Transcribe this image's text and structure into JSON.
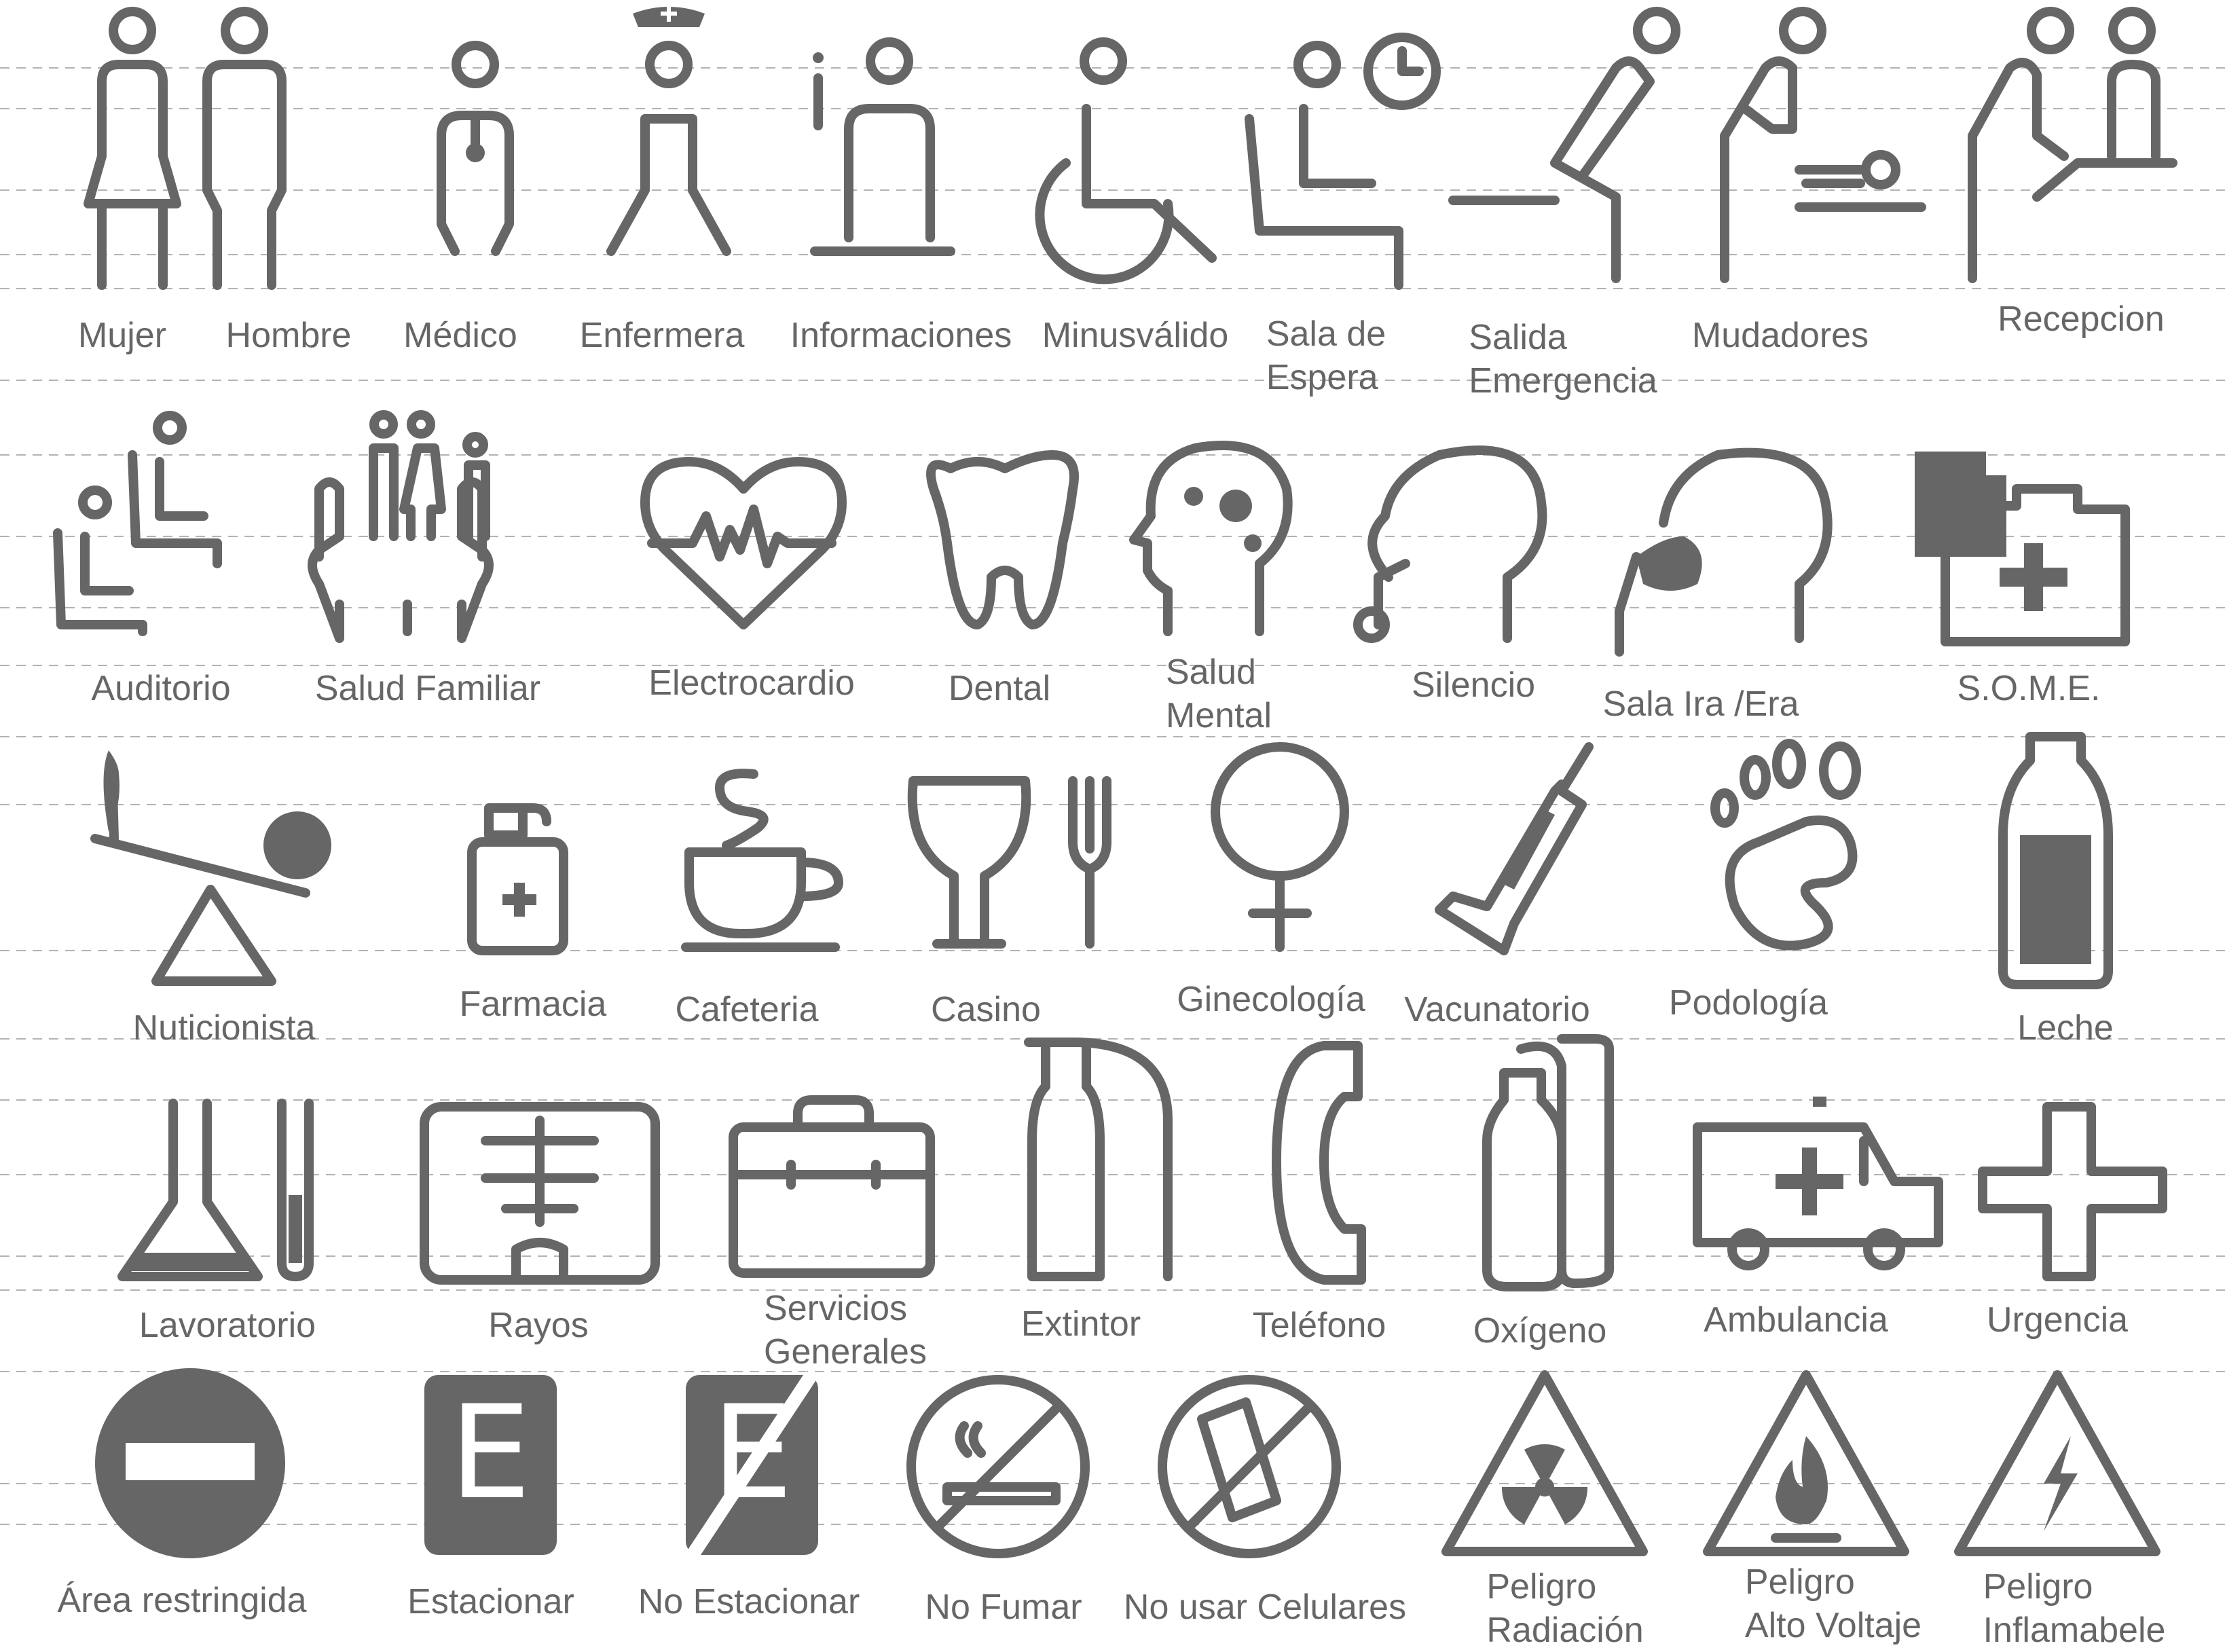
{
  "colors": {
    "icon": "#666666",
    "guides": "#b3b3b3",
    "background": "#ffffff"
  },
  "labels": {
    "mujer": "Mujer",
    "hombre": "Hombre",
    "medico": "Médico",
    "enfermera": "Enfermera",
    "informaciones": "Informaciones",
    "minusvalido": "Minusválido",
    "sala_espera_1": "Sala de",
    "sala_espera_2": "Espera",
    "salida_1": "Salida",
    "salida_2": "Emergencia",
    "mudadores": "Mudadores",
    "recepcion": "Recepcion",
    "auditorio": "Auditorio",
    "salud_familiar": "Salud Familiar",
    "electrocardio": "Electrocardio",
    "dental": "Dental",
    "salud_mental_1": "Salud",
    "salud_mental_2": "Mental",
    "silencio": "Silencio",
    "sala_ira": "Sala Ira /Era",
    "some": "S.O.M.E.",
    "nuticionista": "Nuticionista",
    "farmacia": "Farmacia",
    "cafeteria": "Cafeteria",
    "casino": "Casino",
    "ginecologia": "Ginecología",
    "vacunatorio": "Vacunatorio",
    "podologia": "Podología",
    "leche": "Leche",
    "lavoratorio": "Lavoratorio",
    "rayos": "Rayos",
    "servicios_1": "Servicios",
    "servicios_2": "Generales",
    "extintor": "Extintor",
    "telefono": "Teléfono",
    "oxigeno": "Oxígeno",
    "ambulancia": "Ambulancia",
    "urgencia": "Urgencia",
    "area_restringida": "Área restringida",
    "estacionar": "Estacionar",
    "no_estacionar": "No Estacionar",
    "no_fumar": "No Fumar",
    "no_celulares": "No usar Celulares",
    "peligro_radiacion_1": "Peligro",
    "peligro_radiacion_2": "Radiación",
    "peligro_voltaje_1": "Peligro",
    "peligro_voltaje_2": "Alto Voltaje",
    "peligro_inflamable_1": "Peligro",
    "peligro_inflamable_2": "Inflamabele",
    "parking_letter": "E"
  },
  "icons": [
    "woman-icon",
    "man-icon",
    "doctor-icon",
    "nurse-icon",
    "information-icon",
    "wheelchair-icon",
    "waiting-room-icon",
    "emergency-exit-icon",
    "baby-changing-icon",
    "reception-icon",
    "auditorium-icon",
    "family-health-icon",
    "electrocardiogram-icon",
    "tooth-icon",
    "mental-health-icon",
    "silence-icon",
    "respiratory-room-icon",
    "records-folder-icon",
    "nutrition-scale-icon",
    "pharmacy-bottle-icon",
    "coffee-cup-icon",
    "wine-glass-fork-icon",
    "female-symbol-icon",
    "syringe-icon",
    "footprint-icon",
    "milk-bottle-icon",
    "laboratory-flask-icon",
    "x-ray-icon",
    "toolbox-icon",
    "fire-extinguisher-icon",
    "telephone-icon",
    "oxygen-tank-icon",
    "ambulance-icon",
    "medical-cross-icon",
    "no-entry-icon",
    "parking-icon",
    "no-parking-icon",
    "no-smoking-icon",
    "no-cellphone-icon",
    "radiation-warning-icon",
    "high-voltage-warning-icon",
    "flammable-warning-icon"
  ]
}
